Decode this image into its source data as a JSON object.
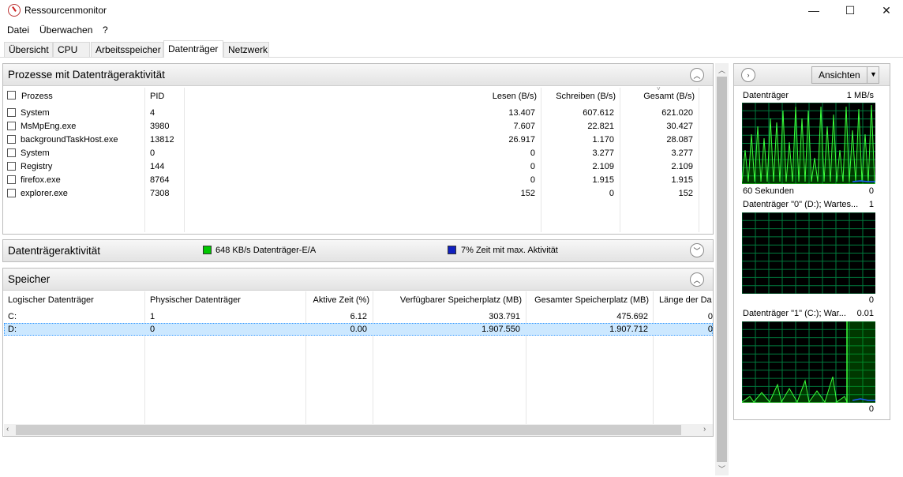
{
  "window": {
    "title": "Ressourcenmonitor",
    "minimize": "—",
    "maximize": "☐",
    "close": "✕"
  },
  "menu": [
    "Datei",
    "Überwachen",
    "?"
  ],
  "tabs": [
    "Übersicht",
    "CPU",
    "Arbeitsspeicher",
    "Datenträger",
    "Netzwerk"
  ],
  "processes": {
    "title": "Prozesse mit Datenträgeraktivität",
    "columns": [
      "Prozess",
      "PID",
      "Lesen (B/s)",
      "Schreiben (B/s)",
      "Gesamt (B/s)"
    ],
    "rows": [
      [
        "System",
        "4",
        "13.407",
        "607.612",
        "621.020"
      ],
      [
        "MsMpEng.exe",
        "3980",
        "7.607",
        "22.821",
        "30.427"
      ],
      [
        "backgroundTaskHost.exe",
        "13812",
        "26.917",
        "1.170",
        "28.087"
      ],
      [
        "System",
        "0",
        "0",
        "3.277",
        "3.277"
      ],
      [
        "Registry",
        "144",
        "0",
        "2.109",
        "2.109"
      ],
      [
        "firefox.exe",
        "8764",
        "0",
        "1.915",
        "1.915"
      ],
      [
        "explorer.exe",
        "7308",
        "152",
        "0",
        "152"
      ]
    ]
  },
  "activity": {
    "title": "Datenträgeraktivität",
    "io": "648 KB/s Datenträger-E/A",
    "io_color": "#00c800",
    "maxtime": "7% Zeit mit max. Aktivität",
    "maxtime_color": "#1020c0"
  },
  "storage": {
    "title": "Speicher",
    "columns": [
      "Logischer Datenträger",
      "Physischer Datenträger",
      "Aktive Zeit (%)",
      "Verfügbarer Speicherplatz (MB)",
      "Gesamter Speicherplatz (MB)",
      "Länge der Da"
    ],
    "rows": [
      [
        "C:",
        "1",
        "6.12",
        "303.791",
        "475.692",
        "0"
      ],
      [
        "D:",
        "0",
        "0.00",
        "1.907.550",
        "1.907.712",
        "0"
      ]
    ]
  },
  "right": {
    "views_label": "Ansichten",
    "graphs": [
      {
        "title": "Datenträger",
        "max": "1 MB/s",
        "footer_left": "60 Sekunden",
        "footer_right": "0"
      },
      {
        "title": "Datenträger \"0\" (D:); Wartes...",
        "max": "1",
        "footer_left": "",
        "footer_right": "0"
      },
      {
        "title": "Datenträger \"1\" (C:); War...",
        "max": "0.01",
        "footer_left": "",
        "footer_right": "0"
      }
    ]
  }
}
